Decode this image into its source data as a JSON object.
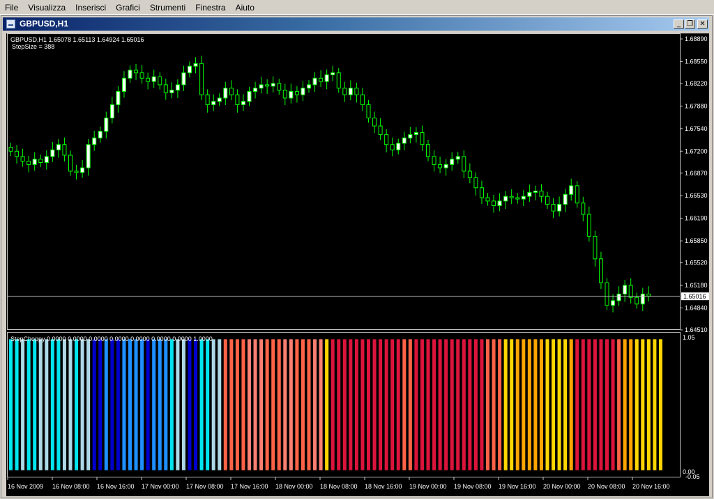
{
  "menu": {
    "items": [
      {
        "label": "File",
        "name": "menu-file"
      },
      {
        "label": "Visualizza",
        "name": "menu-visualizza"
      },
      {
        "label": "Inserisci",
        "name": "menu-inserisci"
      },
      {
        "label": "Grafici",
        "name": "menu-grafici"
      },
      {
        "label": "Strumenti",
        "name": "menu-strumenti"
      },
      {
        "label": "Finestra",
        "name": "menu-finestra"
      },
      {
        "label": "Aiuto",
        "name": "menu-aiuto"
      }
    ]
  },
  "window": {
    "title": "GBPUSD,H1",
    "icon": "chart-window-icon",
    "buttons": {
      "minimize": "_",
      "restore": "❐",
      "close": "✕"
    }
  },
  "chart": {
    "header": "GBPUSD,H1  1.65078 1.65113 1.64924 1.65016",
    "indicator_label": "StepSize = 388",
    "current_price": "1.65016",
    "price_ticks": [
      "1.68890",
      "1.68550",
      "1.68220",
      "1.67880",
      "1.67540",
      "1.67200",
      "1.66870",
      "1.66530",
      "1.66190",
      "1.65850",
      "1.65520",
      "1.65180",
      "1.64840",
      "1.64510"
    ],
    "time_ticks": [
      "16 Nov 2009",
      "16 Nov 08:00",
      "16 Nov 16:00",
      "17 Nov 00:00",
      "17 Nov 08:00",
      "17 Nov 16:00",
      "18 Nov 00:00",
      "18 Nov 08:00",
      "18 Nov 16:00",
      "19 Nov 00:00",
      "19 Nov 08:00",
      "19 Nov 16:00",
      "20 Nov 00:00",
      "20 Nov 08:00",
      "20 Nov 16:00"
    ],
    "sub_label": "StepChoppy 0.0000 0.0000 0.0000 0.0000 0.0000 0.0000 0.0000 1.0000",
    "sub_scale_top": "1.05",
    "sub_scale_bottom_a": "0.00",
    "sub_scale_bottom_b": "-0.05",
    "colors": {
      "background": "#000000",
      "candle": "#00ff00",
      "bull_body": "#ffffff",
      "grid_line": "#c0c0c0",
      "price_tag_bg": "#ffffff"
    }
  },
  "chart_data": [
    {
      "type": "candlestick",
      "title": "GBPUSD,H1",
      "ylim": [
        1.6451,
        1.6889
      ],
      "series": [
        {
          "name": "GBPUSD,H1",
          "close": [
            1.672,
            1.6712,
            1.6705,
            1.67,
            1.6708,
            1.6703,
            1.6712,
            1.6722,
            1.673,
            1.6714,
            1.669,
            1.6688,
            1.6695,
            1.673,
            1.674,
            1.675,
            1.677,
            1.679,
            1.681,
            1.683,
            1.6842,
            1.6838,
            1.683,
            1.6825,
            1.6832,
            1.682,
            1.6808,
            1.6812,
            1.682,
            1.6838,
            1.6848,
            1.6852,
            1.6805,
            1.679,
            1.6795,
            1.68,
            1.6815,
            1.6805,
            1.679,
            1.6795,
            1.681,
            1.6815,
            1.682,
            1.6818,
            1.6822,
            1.6812,
            1.68,
            1.681,
            1.6805,
            1.6815,
            1.682,
            1.683,
            1.6825,
            1.6835,
            1.6838,
            1.6815,
            1.6805,
            1.6815,
            1.6805,
            1.679,
            1.677,
            1.6758,
            1.6745,
            1.673,
            1.6722,
            1.6732,
            1.674,
            1.6745,
            1.6748,
            1.673,
            1.6712,
            1.67,
            1.6695,
            1.67,
            1.6708,
            1.6712,
            1.669,
            1.668,
            1.6665,
            1.665,
            1.6645,
            1.6638,
            1.6645,
            1.6652,
            1.665,
            1.6648,
            1.6652,
            1.6658,
            1.666,
            1.6652,
            1.664,
            1.663,
            1.664,
            1.6655,
            1.6668,
            1.6642,
            1.6625,
            1.6592,
            1.6558,
            1.6522,
            1.6488,
            1.6495,
            1.6505,
            1.6518,
            1.65,
            1.649,
            1.6505,
            1.6502
          ]
        }
      ],
      "xlabel": "",
      "ylabel": ""
    },
    {
      "type": "bar",
      "title": "StepChoppy",
      "ylim": [
        -0.05,
        1.05
      ],
      "bar_count": 112,
      "color_groups": [
        {
          "color": "#00e5ee",
          "count": 2
        },
        {
          "color": "#add8e6",
          "count": 1
        },
        {
          "color": "#00e5ee",
          "count": 2
        },
        {
          "color": "#add8e6",
          "count": 2
        },
        {
          "color": "#00e5ee",
          "count": 2
        },
        {
          "color": "#add8e6",
          "count": 2
        },
        {
          "color": "#00e5ee",
          "count": 1
        },
        {
          "color": "#add8e6",
          "count": 2
        },
        {
          "color": "#0000cd",
          "count": 2
        },
        {
          "color": "#1e90ff",
          "count": 1
        },
        {
          "color": "#0000cd",
          "count": 2
        },
        {
          "color": "#1e90ff",
          "count": 4
        },
        {
          "color": "#0000cd",
          "count": 1
        },
        {
          "color": "#1e90ff",
          "count": 3
        },
        {
          "color": "#00e5ee",
          "count": 1
        },
        {
          "color": "#add8e6",
          "count": 2
        },
        {
          "color": "#0000cd",
          "count": 2
        },
        {
          "color": "#00e5ee",
          "count": 2
        },
        {
          "color": "#add8e6",
          "count": 2
        },
        {
          "color": "#ff6347",
          "count": 4
        },
        {
          "color": "#fa8072",
          "count": 3
        },
        {
          "color": "#ff6347",
          "count": 3
        },
        {
          "color": "#fa8072",
          "count": 2
        },
        {
          "color": "#ff6347",
          "count": 3
        },
        {
          "color": "#fa8072",
          "count": 2
        },
        {
          "color": "#ffd700",
          "count": 1
        },
        {
          "color": "#dc143c",
          "count": 12
        },
        {
          "color": "#ff6347",
          "count": 2
        },
        {
          "color": "#dc143c",
          "count": 12
        },
        {
          "color": "#ff6347",
          "count": 3
        },
        {
          "color": "#ffd700",
          "count": 2
        },
        {
          "color": "#ffa500",
          "count": 5
        },
        {
          "color": "#ffd700",
          "count": 4
        },
        {
          "color": "#ffa500",
          "count": 1
        },
        {
          "color": "#dc143c",
          "count": 7
        },
        {
          "color": "#ff6347",
          "count": 1
        },
        {
          "color": "#ffa500",
          "count": 2
        },
        {
          "color": "#ffd700",
          "count": 5
        }
      ]
    }
  ]
}
